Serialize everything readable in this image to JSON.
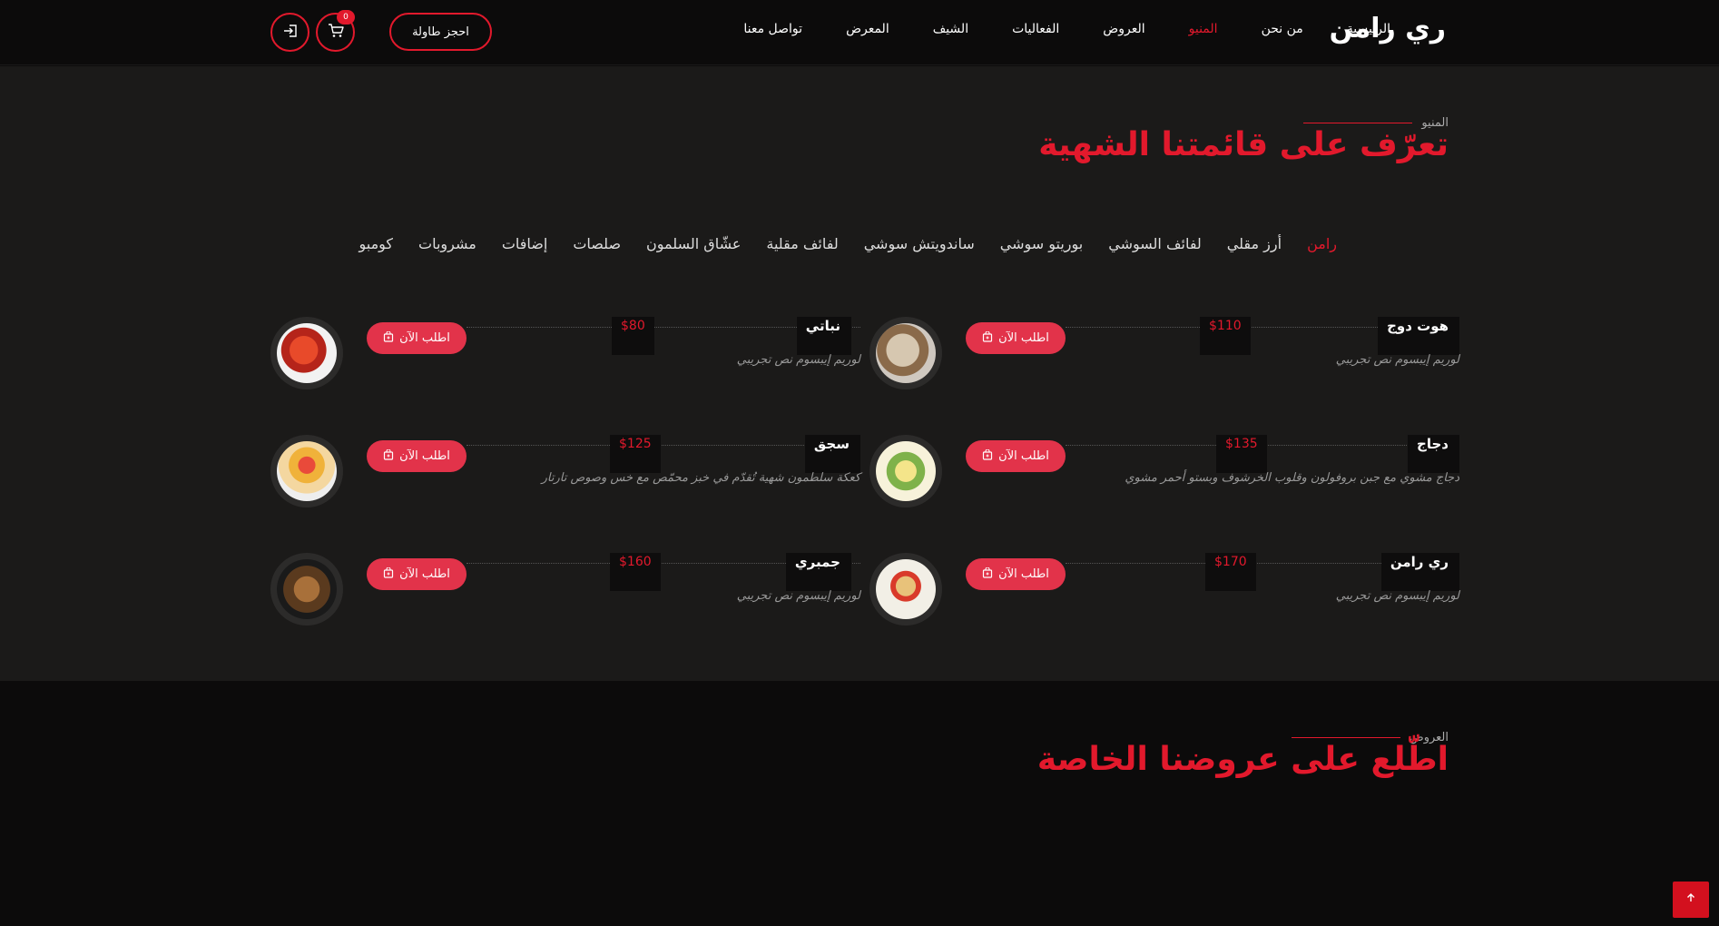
{
  "header": {
    "brand": "ري رامن",
    "nav": [
      {
        "label": "الرئيسية",
        "active": false
      },
      {
        "label": "من نحن",
        "active": false
      },
      {
        "label": "المنيو",
        "active": true
      },
      {
        "label": "العروض",
        "active": false
      },
      {
        "label": "الفعاليات",
        "active": false
      },
      {
        "label": "الشيف",
        "active": false
      },
      {
        "label": "المعرض",
        "active": false
      },
      {
        "label": "تواصل معنا",
        "active": false
      }
    ],
    "book_label": "احجز طاولة",
    "cart_count": "0",
    "cart_icon": "cart-icon",
    "login_icon": "login-icon"
  },
  "menu": {
    "subtitle": "المنيو",
    "title": "تعرّف على قائمتنا الشهية",
    "categories": [
      {
        "label": "رامن",
        "active": true
      },
      {
        "label": "أرز مقلي",
        "active": false
      },
      {
        "label": "لفائف السوشي",
        "active": false
      },
      {
        "label": "بوريتو سوشي",
        "active": false
      },
      {
        "label": "ساندويتش سوشي",
        "active": false
      },
      {
        "label": "لفائف مقلية",
        "active": false
      },
      {
        "label": "عشّاق السلمون",
        "active": false
      },
      {
        "label": "صلصات",
        "active": false
      },
      {
        "label": "إضافات",
        "active": false
      },
      {
        "label": "مشروبات",
        "active": false
      },
      {
        "label": "كومبو",
        "active": false
      }
    ],
    "order_label": "اطلب الآن",
    "items": [
      {
        "name": "هوت دوج",
        "price": "$110",
        "desc": "لوريم إيبسوم نص تجريبي"
      },
      {
        "name": "نباتي",
        "price": "$80",
        "desc": "لوريم إيبسوم نص تجريبي"
      },
      {
        "name": "دجاج",
        "price": "$135",
        "desc": "دجاج مشوي مع جبن بروفولون وقلوب الخرشوف وبستو أحمر مشوي"
      },
      {
        "name": "سجق",
        "price": "$125",
        "desc": "كعكة سلطمون شهية تُقدّم في خبز محمّص مع خس وصوص تارتار"
      },
      {
        "name": "ري رامن",
        "price": "$170",
        "desc": "لوريم إيبسوم نص تجريبي"
      },
      {
        "name": "جمبري",
        "price": "$160",
        "desc": "لوريم إيبسوم نص تجريبي"
      }
    ]
  },
  "offers": {
    "subtitle": "العروض",
    "title": "اطّلع على عروضنا الخاصة"
  },
  "to_top_icon": "arrow-up-icon",
  "colors": {
    "accent": "#e2192c",
    "button": "#e2334a",
    "bg_dark": "#0c0b0b",
    "bg_section": "#1b1a19"
  }
}
